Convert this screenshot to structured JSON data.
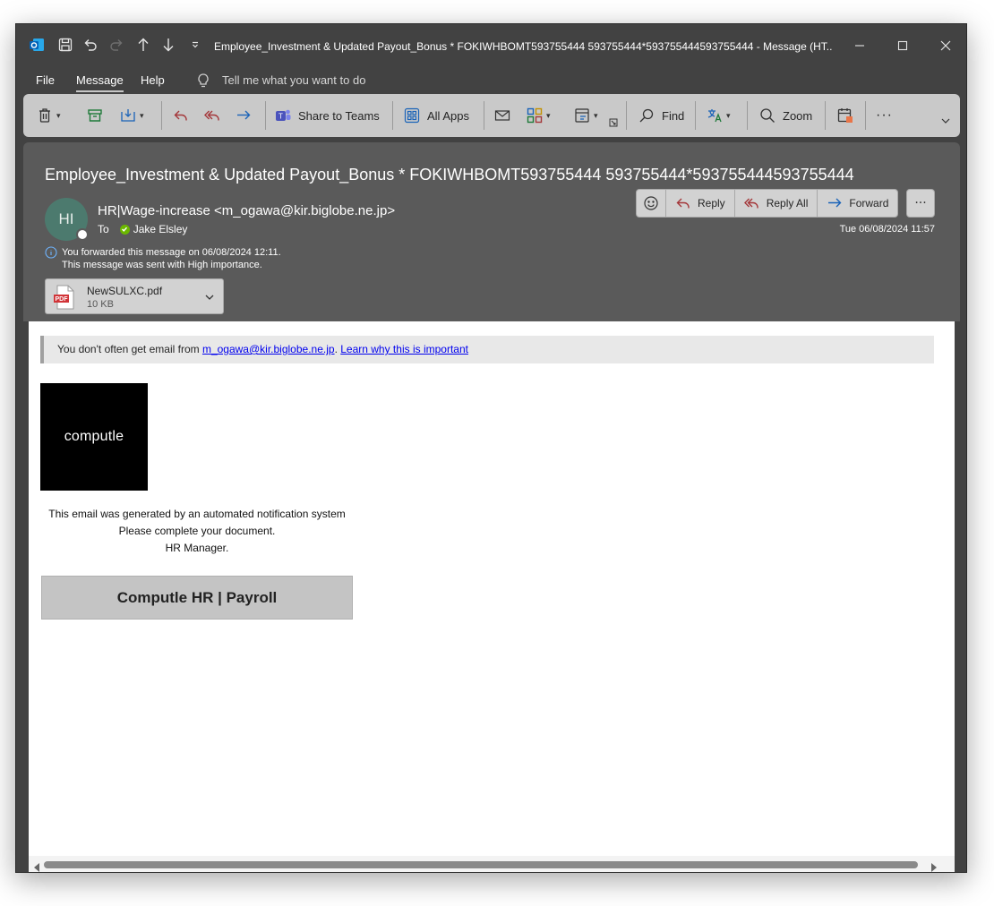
{
  "window": {
    "title": "Employee_Investment & Updated Payout_Bonus * FOKIWHBOMT593755444 593755444*593755444593755444  -  Message (HT..."
  },
  "menu": {
    "items": [
      "File",
      "Message",
      "Help"
    ],
    "active": "Message",
    "tell_me": "Tell me what you want to do"
  },
  "ribbon": {
    "share_to_teams": "Share to Teams",
    "all_apps": "All Apps",
    "find": "Find",
    "zoom": "Zoom"
  },
  "message": {
    "subject": "Employee_Investment & Updated Payout_Bonus * FOKIWHBOMT593755444 593755444*593755444593755444",
    "avatar_initials": "HI",
    "sender": "HR|Wage-increase <m_ogawa@kir.biglobe.ne.jp>",
    "to_label": "To",
    "recipient": "Jake Elsley",
    "info_forwarded": "You forwarded this message on 06/08/2024 12:11.",
    "info_importance": "This message was sent with High importance.",
    "date": "Tue 06/08/2024 11:57",
    "actions": {
      "reply": "Reply",
      "reply_all": "Reply All",
      "forward": "Forward"
    },
    "attachment": {
      "name": "NewSULXC.pdf",
      "size": "10 KB",
      "badge": "PDF"
    }
  },
  "body": {
    "warning_prefix": "You don't often get email from ",
    "warning_email": "m_ogawa@kir.biglobe.ne.jp",
    "warning_sep": ". ",
    "warning_link": "Learn why this is important",
    "logo_text": "computle",
    "lines": [
      "This email was generated by an automated notification system",
      "Please complete your document.",
      "HR Manager."
    ],
    "cta": "Computle HR | Payroll"
  },
  "colors": {
    "window_bg": "#424242",
    "ribbon_bg": "#c9c9c9",
    "header_bg": "#5a5a5a",
    "reply_accent": "#a4373a",
    "forward_accent": "#1a63b8",
    "presence_ok": "#6bb700"
  }
}
